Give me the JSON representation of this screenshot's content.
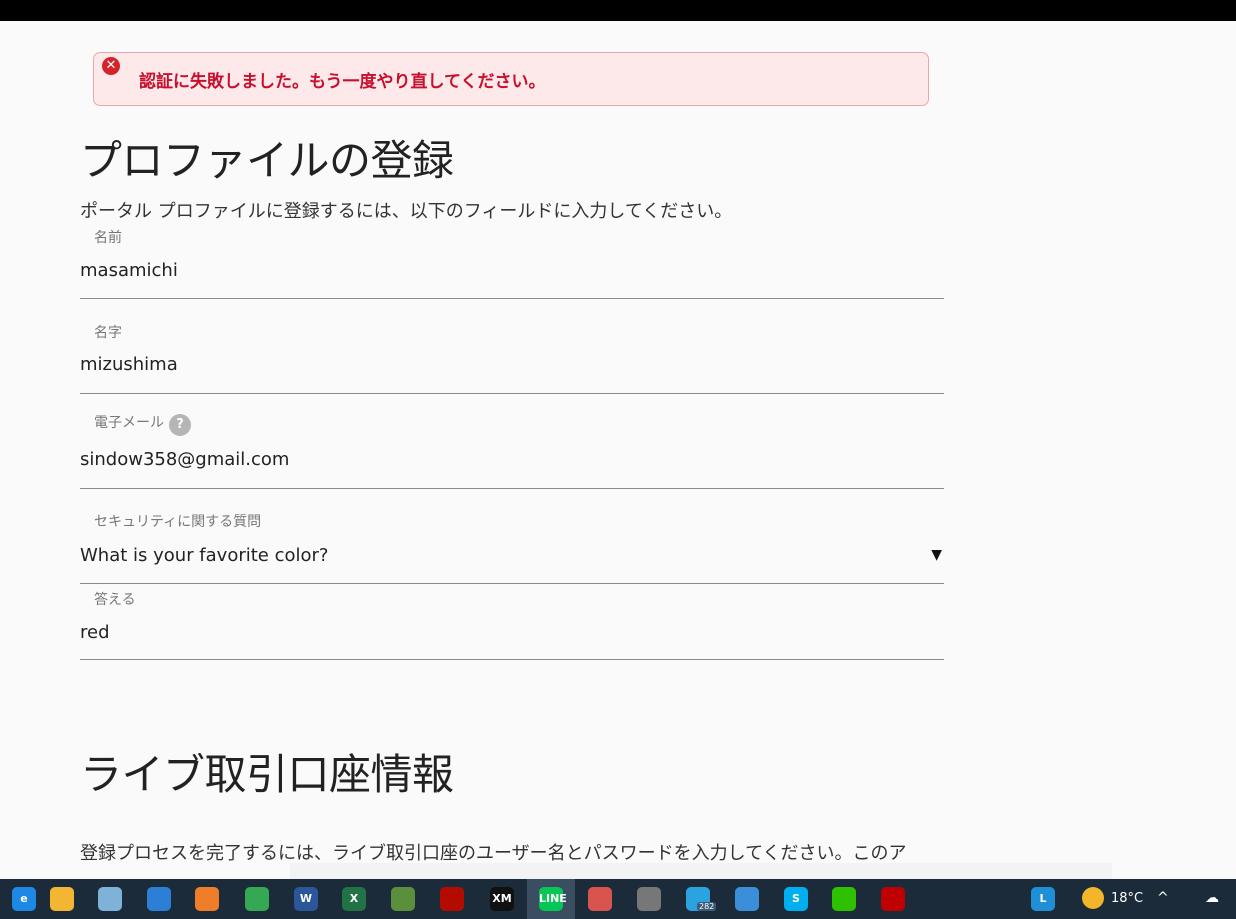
{
  "alert": {
    "icon": "error-icon",
    "message": "認証に失敗しました。もう一度やり直してください。"
  },
  "profile": {
    "title": "プロファイルの登録",
    "intro": "ポータル プロファイルに登録するには、以下のフィールドに入力してください。",
    "fields": [
      {
        "label": "名前",
        "value": "masamichi"
      },
      {
        "label": "名字",
        "value": "mizushima"
      },
      {
        "label": "電子メール",
        "value": "sindow358@gmail.com",
        "help_icon": "help-icon",
        "help_glyph": "?"
      },
      {
        "label": "セキュリティに関する質問",
        "value": "What is your favorite color?",
        "caret": "▼"
      },
      {
        "label": "答える",
        "value": "red"
      }
    ]
  },
  "live": {
    "title": "ライブ取引口座情報",
    "intro": "登録プロセスを完了するには、ライブ取引口座のユーザー名とパスワードを入力してください。このア"
  },
  "taskbar": {
    "apps": [
      {
        "name": "edge-icon",
        "color": "#1e88e5",
        "glyph": "e"
      },
      {
        "name": "file-explorer-icon",
        "color": "#f2b632",
        "glyph": ""
      },
      {
        "name": "notes-icon",
        "color": "#7fb2d8",
        "glyph": ""
      },
      {
        "name": "photos-icon",
        "color": "#2d7fd6",
        "glyph": ""
      },
      {
        "name": "media-player-icon",
        "color": "#ef7d2a",
        "glyph": ""
      },
      {
        "name": "chrome-icon",
        "color": "#34a853",
        "glyph": ""
      },
      {
        "name": "word-icon",
        "color": "#2b579a",
        "glyph": "W"
      },
      {
        "name": "excel-icon",
        "color": "#217346",
        "glyph": "X"
      },
      {
        "name": "app-icon",
        "color": "#5b8f3c",
        "glyph": ""
      },
      {
        "name": "acrobat-icon",
        "color": "#b30b00",
        "glyph": ""
      },
      {
        "name": "xm-icon",
        "color": "#111111",
        "glyph": "XM"
      },
      {
        "name": "line-icon",
        "color": "#06c755",
        "glyph": "LINE",
        "active": true
      },
      {
        "name": "office-icon",
        "color": "#d9534f",
        "glyph": ""
      },
      {
        "name": "yandex-icon",
        "color": "#777777",
        "glyph": ""
      },
      {
        "name": "telegram-icon",
        "color": "#2aa3df",
        "glyph": "",
        "badge": "282"
      },
      {
        "name": "vpn-icon",
        "color": "#3a8fd8",
        "glyph": ""
      },
      {
        "name": "skype-icon",
        "color": "#00aff0",
        "glyph": "S"
      },
      {
        "name": "wechat-icon",
        "color": "#2dc100",
        "glyph": ""
      },
      {
        "name": "filezilla-icon",
        "color": "#bf0000",
        "glyph": ""
      },
      {
        "name": "launcher-icon",
        "color": "#1f8fd6",
        "glyph": "L"
      }
    ],
    "weather_icon": "weather-icon",
    "temperature": "18°C",
    "tray": {
      "chevron": "^",
      "cloud_icon": "cloud-icon"
    }
  }
}
